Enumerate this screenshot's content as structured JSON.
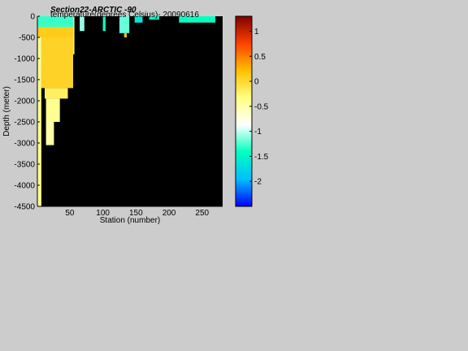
{
  "figure": {
    "title_line1": "Section22-ARCTIC  -90",
    "title_line2": "temperature(degrees Celsius)- 20090616"
  },
  "colors": {
    "background": "#cccccc",
    "plot_fill": "#000000",
    "colormap": [
      "#0000ff",
      "#00bfff",
      "#00ffbf",
      "#ffffff",
      "#ffff80",
      "#ffbf00",
      "#ff4000",
      "#800000"
    ]
  },
  "chart_data": {
    "type": "heatmap",
    "title": "temperature(degrees Celsius)- 20090616",
    "xlabel": "Station (number)",
    "ylabel": "Depth (meter)",
    "xlim": [
      1,
      281
    ],
    "ylim": [
      -4500,
      0
    ],
    "x_ticks": [
      50,
      100,
      150,
      200,
      250
    ],
    "y_ticks": [
      0,
      -500,
      -1000,
      -1500,
      -2000,
      -2500,
      -3000,
      -3500,
      -4000,
      -4500
    ],
    "colorbar": {
      "range": [
        -2.5,
        1.3
      ],
      "ticks": [
        1,
        0.5,
        0,
        -0.5,
        -1,
        -1.5,
        -2
      ]
    },
    "regions": [
      {
        "x0": 1,
        "x1": 55,
        "y0": 0,
        "y1": -250,
        "value": -1.3
      },
      {
        "x0": 1,
        "x1": 55,
        "y0": -250,
        "y1": -500,
        "value": 0.1
      },
      {
        "x0": 7,
        "x1": 55,
        "y0": -500,
        "y1": -1700,
        "value": 0.05
      },
      {
        "x0": 55,
        "x1": 57,
        "y0": 0,
        "y1": -900,
        "value": -0.2
      },
      {
        "x0": 12,
        "x1": 47,
        "y0": -1700,
        "y1": -1950,
        "value": -0.2
      },
      {
        "x0": 14,
        "x1": 35,
        "y0": -1950,
        "y1": -2500,
        "value": -0.4
      },
      {
        "x0": 14,
        "x1": 26,
        "y0": -2500,
        "y1": -3050,
        "value": -0.5
      },
      {
        "x0": 1,
        "x1": 7,
        "y0": -500,
        "y1": -4500,
        "value": -0.4
      },
      {
        "x0": 65,
        "x1": 72,
        "y0": 0,
        "y1": -350,
        "value": -1.1
      },
      {
        "x0": 100,
        "x1": 104,
        "y0": 0,
        "y1": -350,
        "value": -1.4
      },
      {
        "x0": 125,
        "x1": 140,
        "y0": 0,
        "y1": -400,
        "value": -1.2
      },
      {
        "x0": 132,
        "x1": 136,
        "y0": -400,
        "y1": -500,
        "value": 0.2
      },
      {
        "x0": 148,
        "x1": 160,
        "y0": 0,
        "y1": -150,
        "value": -1.6
      },
      {
        "x0": 170,
        "x1": 185,
        "y0": 0,
        "y1": -80,
        "value": -1.5
      },
      {
        "x0": 215,
        "x1": 270,
        "y0": 0,
        "y1": -150,
        "value": -1.4
      }
    ]
  }
}
